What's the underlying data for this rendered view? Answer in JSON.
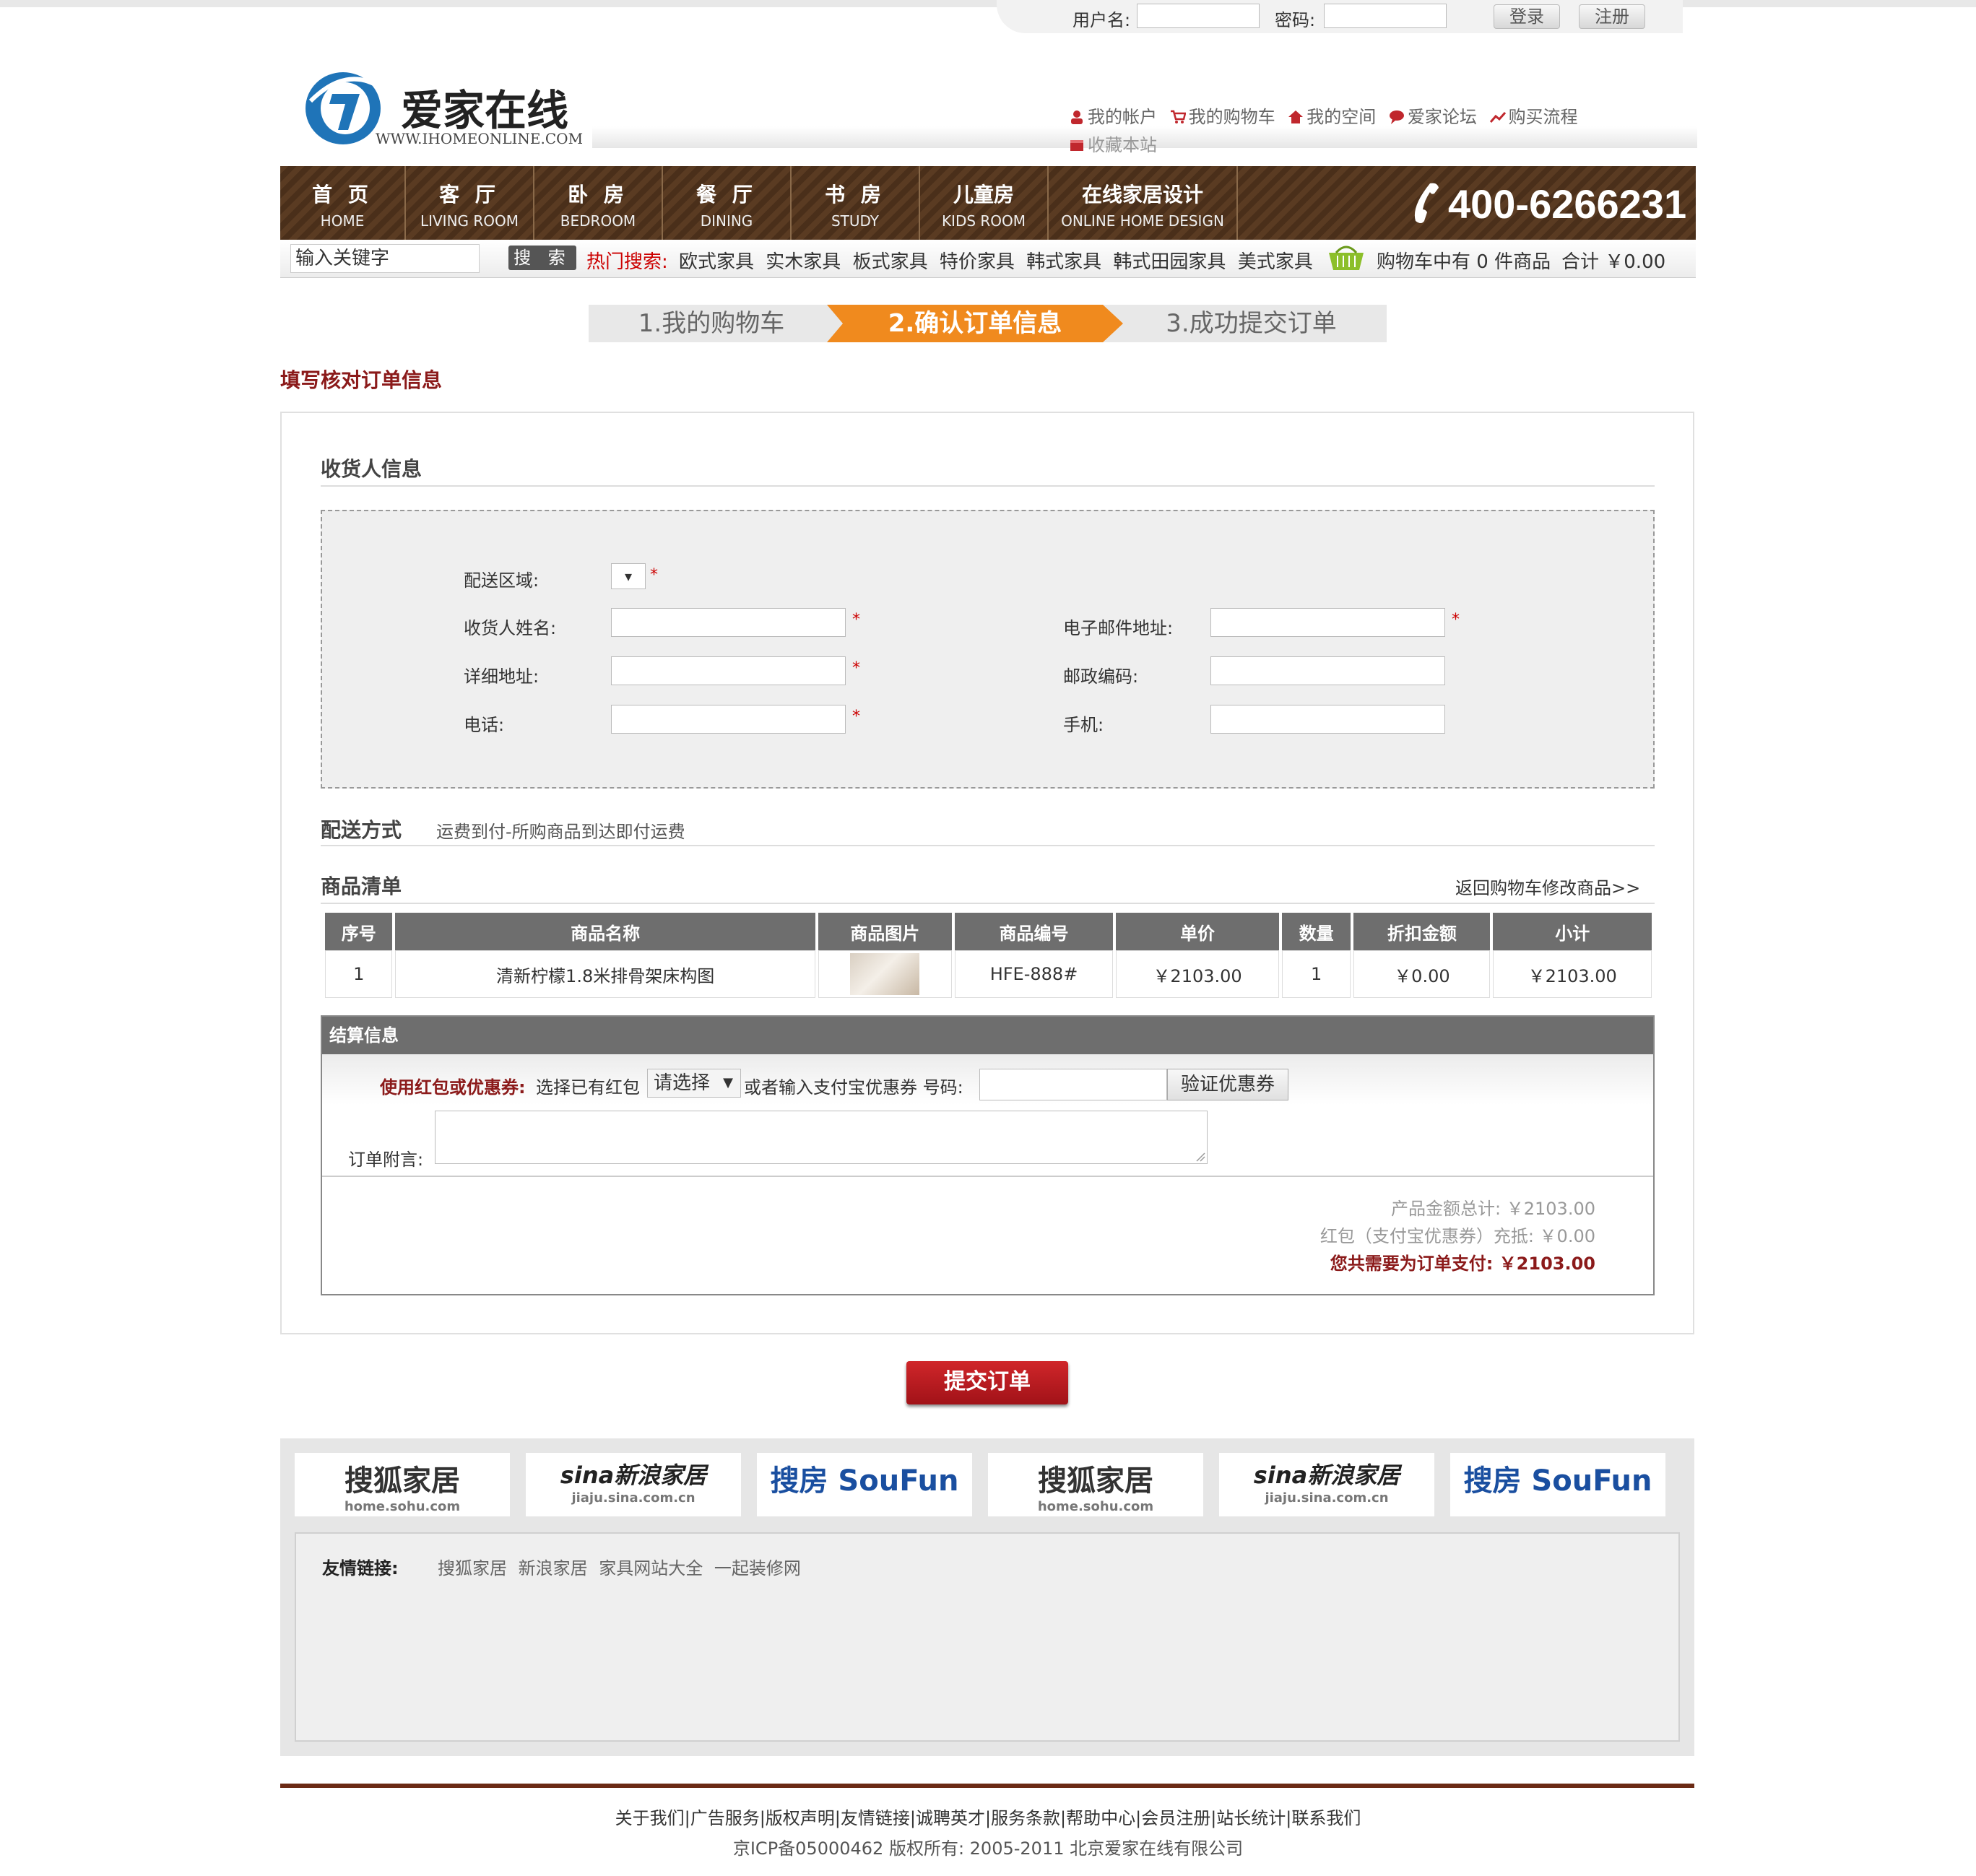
{
  "login": {
    "username_label": "用户名:",
    "password_label": "密码:",
    "login_button": "登录",
    "register_button": "注册"
  },
  "brand": {
    "name": "爱家在线",
    "url_text": "WWW.IHOMEONLINE.COM"
  },
  "quick_links": [
    "我的帐户",
    "我的购物车",
    "我的空间",
    "爱家论坛",
    "购买流程",
    "收藏本站"
  ],
  "nav": [
    {
      "cn": "首 页",
      "en": "HOME"
    },
    {
      "cn": "客 厅",
      "en": "LIVING ROOM"
    },
    {
      "cn": "卧 房",
      "en": "BEDROOM"
    },
    {
      "cn": "餐 厅",
      "en": "DINING"
    },
    {
      "cn": "书 房",
      "en": "STUDY"
    },
    {
      "cn": "儿童房",
      "en": "KIDS ROOM"
    },
    {
      "cn": "在线家居设计",
      "en": "ONLINE HOME DESIGN"
    }
  ],
  "phone": "400-6266231",
  "search": {
    "input_text": "输入关键字",
    "button": "搜 索",
    "hot_label": "热门搜索:",
    "hot_terms": [
      "欧式家具",
      "实木家具",
      "板式家具",
      "特价家具",
      "韩式家具",
      "韩式田园家具",
      "美式家具"
    ]
  },
  "cart": {
    "summary": "购物车中有 0 件商品",
    "total": "合计 ￥0.00"
  },
  "steps": [
    "1.我的购物车",
    "2.确认订单信息",
    "3.成功提交订单"
  ],
  "page_title": "填写核对订单信息",
  "receiver": {
    "section_title": "收货人信息",
    "area_label": "配送区域:",
    "area_select": "▾",
    "name_label": "收货人姓名:",
    "email_label": "电子邮件地址:",
    "address_label": "详细地址:",
    "zip_label": "邮政编码:",
    "phone_label": "电话:",
    "mobile_label": "手机:",
    "required_mark": "*"
  },
  "shipping": {
    "label": "配送方式",
    "text": "运费到付-所购商品到达即付运费"
  },
  "goods": {
    "section_title": "商品清单",
    "back_link": "返回购物车修改商品>>",
    "columns": [
      "序号",
      "商品名称",
      "商品图片",
      "商品编号",
      "单价",
      "数量",
      "折扣金额",
      "小计"
    ],
    "rows": [
      {
        "no": "1",
        "name": "清新柠檬1.8米排骨架床构图",
        "code": "HFE-888#",
        "price": "￥2103.00",
        "qty": "1",
        "discount": "￥0.00",
        "subtotal": "￥2103.00"
      }
    ]
  },
  "settlement": {
    "title": "结算信息",
    "coupon_label": "使用红包或优惠券:",
    "choose_text": "选择已有红包",
    "select_value": "请选择",
    "or_text": "或者输入支付宝优惠券 号码:",
    "verify_button": "验证优惠券",
    "note_label": "订单附言:",
    "product_total": "产品金额总计: ￥2103.00",
    "coupon_offset": "红包（支付宝优惠券）充抵: ￥0.00",
    "pay_total": "您共需要为订单支付: ￥2103.00"
  },
  "submit_button": "提交订单",
  "partners": [
    {
      "main": "搜狐家居",
      "sub": "home.sohu.com"
    },
    {
      "main": "sina新浪家居",
      "sub": "jiaju.sina.com.cn"
    },
    {
      "main": "搜房 SouFun",
      "sub": ""
    },
    {
      "main": "搜狐家居",
      "sub": "home.sohu.com"
    },
    {
      "main": "sina新浪家居",
      "sub": "jiaju.sina.com.cn"
    },
    {
      "main": "搜房 SouFun",
      "sub": ""
    }
  ],
  "friend_links": {
    "label": "友情链接:",
    "items": [
      "搜狐家居",
      "新浪家居",
      "家具网站大全",
      "一起装修网"
    ]
  },
  "footer": {
    "links": "关于我们|广告服务|版权声明|友情链接|诚聘英才|服务条款|帮助中心|会员注册|站长统计|联系我们",
    "copyright": "京ICP备05000462 版权所有: 2005-2011 北京爱家在线有限公司"
  },
  "colors": {
    "nav_brown": "#5a3b22",
    "accent_orange": "#f08a1e",
    "dark_red": "#8b1a1a",
    "header_gray": "#6e6e6e"
  }
}
